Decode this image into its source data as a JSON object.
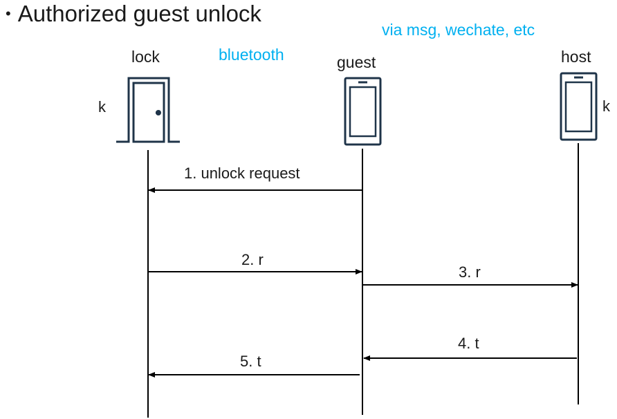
{
  "title": {
    "bullet": "•",
    "text": "Authorized guest unlock"
  },
  "channels": {
    "bluetooth": "bluetooth",
    "messaging": "via msg, wechate, etc"
  },
  "actors": {
    "lock": "lock",
    "guest": "guest",
    "host": "host"
  },
  "keys": {
    "lock_key": "k",
    "host_key": "k"
  },
  "icons": {
    "lock": "door-icon",
    "guest": "phone-icon",
    "host": "phone-icon"
  },
  "messages": [
    {
      "label": "1. unlock request",
      "from": "guest",
      "to": "lock"
    },
    {
      "label": "2. r",
      "from": "lock",
      "to": "guest"
    },
    {
      "label": "3. r",
      "from": "guest",
      "to": "host"
    },
    {
      "label": "4. t",
      "from": "host",
      "to": "guest"
    },
    {
      "label": "5. t",
      "from": "guest",
      "to": "lock"
    }
  ],
  "colors": {
    "line": "#000000",
    "icon": "#1f3449",
    "channel": "#00b0f0"
  }
}
